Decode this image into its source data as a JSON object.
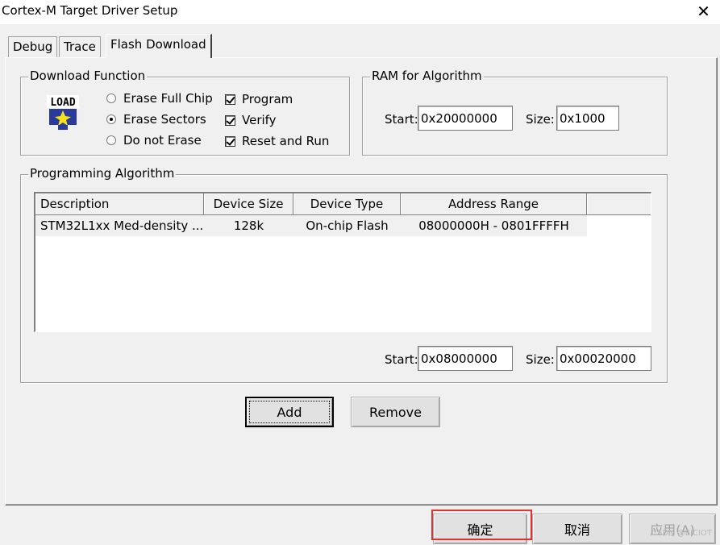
{
  "window": {
    "title": "Cortex-M Target Driver Setup",
    "close_symbol": "✕"
  },
  "tabs": [
    {
      "label": "Debug",
      "active": false
    },
    {
      "label": "Trace",
      "active": false
    },
    {
      "label": "Flash Download",
      "active": true
    }
  ],
  "download_function": {
    "group_label": "Download Function",
    "icon": "load-icon",
    "icon_text": "LOAD",
    "radios": [
      {
        "label": "Erase Full Chip",
        "checked": false
      },
      {
        "label": "Erase Sectors",
        "checked": true
      },
      {
        "label": "Do not Erase",
        "checked": false
      }
    ],
    "checkboxes": [
      {
        "label": "Program",
        "checked": true
      },
      {
        "label": "Verify",
        "checked": true
      },
      {
        "label": "Reset and Run",
        "checked": true
      }
    ]
  },
  "ram_for_algorithm": {
    "group_label": "RAM for Algorithm",
    "start_label": "Start:",
    "start_value": "0x20000000",
    "size_label": "Size:",
    "size_value": "0x1000"
  },
  "programming_algorithm": {
    "group_label": "Programming Algorithm",
    "columns": [
      "Description",
      "Device Size",
      "Device Type",
      "Address Range"
    ],
    "rows": [
      [
        "STM32L1xx Med-density ...",
        "128k",
        "On-chip Flash",
        "08000000H - 0801FFFFH"
      ]
    ],
    "start_label": "Start:",
    "start_value": "0x08000000",
    "size_label": "Size:",
    "size_value": "0x00020000"
  },
  "buttons": {
    "add": "Add",
    "remove": "Remove",
    "ok": "确定",
    "cancel": "取消",
    "apply": "应用(A)"
  },
  "watermark": "CSDN @EICIOT",
  "colors": {
    "highlight": "#e0312d",
    "window_bg": "#f0f0f0"
  }
}
